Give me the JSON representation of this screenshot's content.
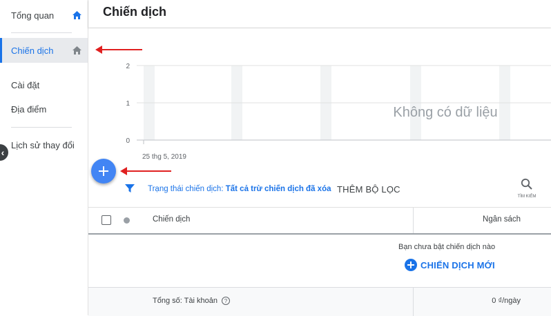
{
  "sidebar": {
    "items": [
      {
        "label": "Tổng quan",
        "icon": "home-icon"
      },
      {
        "label": "Chiến dịch",
        "icon": "home-icon"
      },
      {
        "label": "Cài đặt"
      },
      {
        "label": "Địa điểm"
      },
      {
        "label": "Lịch sử thay đổi"
      }
    ],
    "collapse_glyph": "‹"
  },
  "header": {
    "title": "Chiến dịch"
  },
  "chart": {
    "y_ticks": [
      "2",
      "1",
      "0"
    ],
    "x_start_label": "25 thg 5, 2019",
    "empty_label": "Không có dữ liệu",
    "bar_color": "#f1f3f4",
    "grid_color": "#e0e0e0"
  },
  "filter_bar": {
    "status_prefix": "Trạng thái chiến dịch: ",
    "status_value": "Tất cả trừ chiến dịch đã xóa",
    "add_filter_label": "THÊM BỘ LỌC",
    "search_label": "TÌM KIẾM"
  },
  "table": {
    "headers": {
      "campaign": "Chiến dịch",
      "budget": "Ngân sách"
    },
    "empty_message": "Bạn chưa bật chiến dịch nào",
    "new_campaign_label": "CHIẾN DỊCH MỚI",
    "total_label": "Tổng số: Tài khoản",
    "total_budget": "0 ₫/ngày"
  },
  "colors": {
    "accent": "#1a73e8",
    "annotation_arrow": "#e02020",
    "fab": "#4285f4"
  }
}
